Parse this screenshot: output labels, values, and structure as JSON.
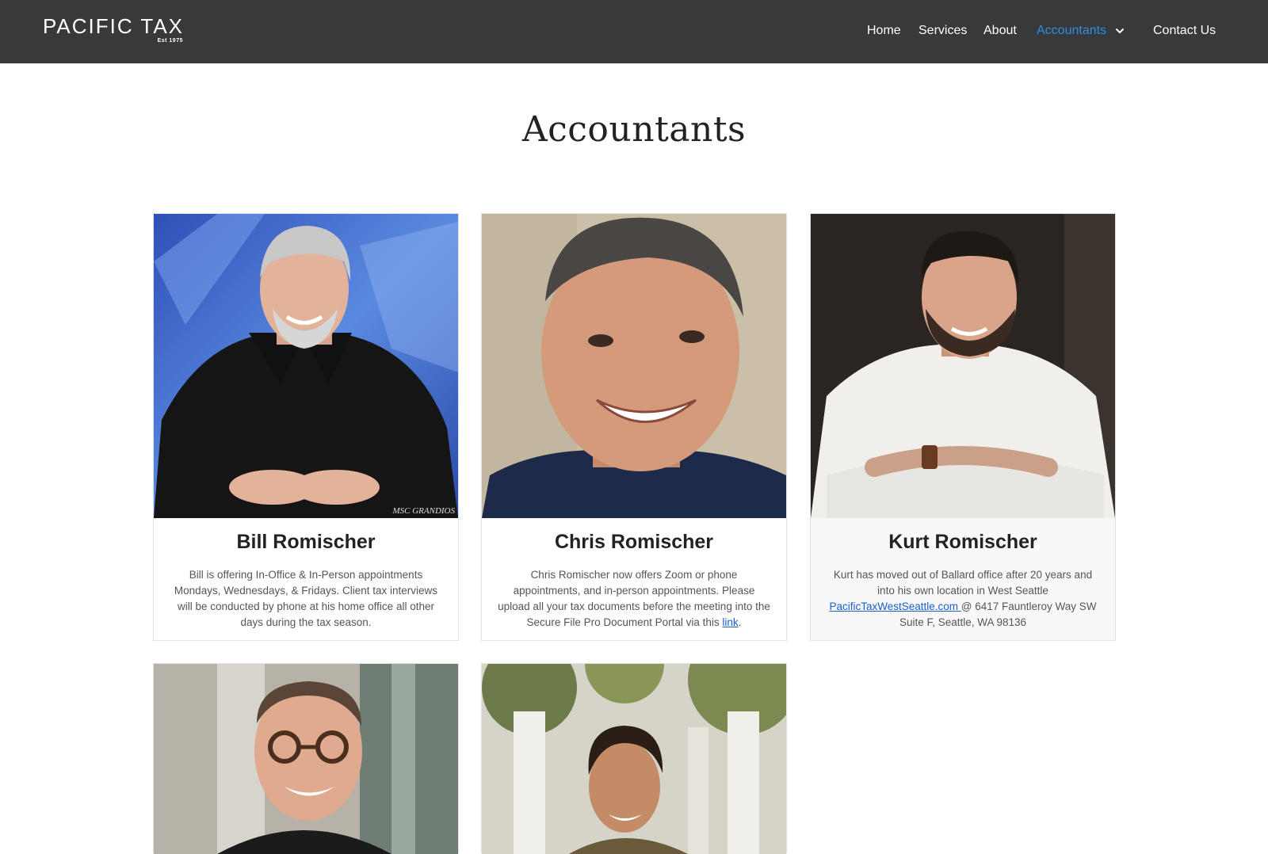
{
  "brand": {
    "name": "PACIFIC TAX",
    "tagline": "Est 1975"
  },
  "nav": {
    "items": [
      {
        "label": "Home"
      },
      {
        "label": "Services"
      },
      {
        "label": "About"
      },
      {
        "label": "Accountants",
        "active": true
      },
      {
        "label": "Contact Us"
      }
    ],
    "active_color": "#2f8fe0",
    "header_bg": "#38393b"
  },
  "page": {
    "title": "Accountants"
  },
  "accountants": [
    {
      "name": "Bill Romischer",
      "description": "Bill is offering In-Office & In-Person appointments Mondays, Wednesdays, & Fridays. Client tax interviews will be conducted by phone at his home office all other days during the tax season.",
      "photo_watermark": "MSC GRANDIOS"
    },
    {
      "name": "Chris Romischer",
      "description_before_link": "Chris Romischer now offers Zoom or phone appointments, and in-person appointments. Please upload all your tax documents before the meeting into the Secure File Pro Document Portal via this ",
      "link_text": "link",
      "description_after_link": "."
    },
    {
      "name": "Kurt Romischer",
      "description_before_link": "Kurt has moved out of Ballard office after 20 years and into his own location in West Seattle ",
      "link_text": "PacificTaxWestSeattle.com ",
      "description_after_link": " @ 6417 Fauntleroy Way SW Suite F, Seattle, WA 98136"
    },
    {
      "name": "",
      "photo_only": true
    },
    {
      "name": "",
      "photo_only": true
    }
  ]
}
